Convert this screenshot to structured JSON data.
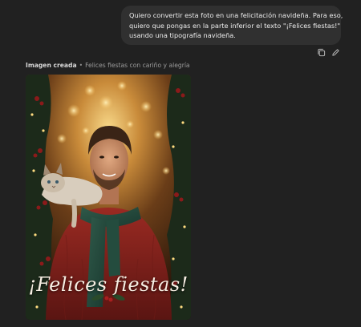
{
  "user_message": {
    "lines": [
      "Quiero convertir esta foto en una felicitación navideña. Para eso,",
      "quiero que pongas en la parte inferior el texto \"¡Felices fiestas!\"",
      "usando una tipografía navideña."
    ]
  },
  "message_actions": {
    "copy_icon": "copy-icon",
    "edit_icon": "pencil-icon"
  },
  "image_header": {
    "label": "Imagen creada",
    "separator": "•",
    "caption": "Felices fiestas con cariño y alegría"
  },
  "generated_image": {
    "greeting": "¡Felices fiestas!"
  },
  "colors": {
    "page_background": "#212121",
    "bubble_background": "#303030",
    "bubble_text": "#ececec",
    "header_text": "#b4b4b4"
  }
}
